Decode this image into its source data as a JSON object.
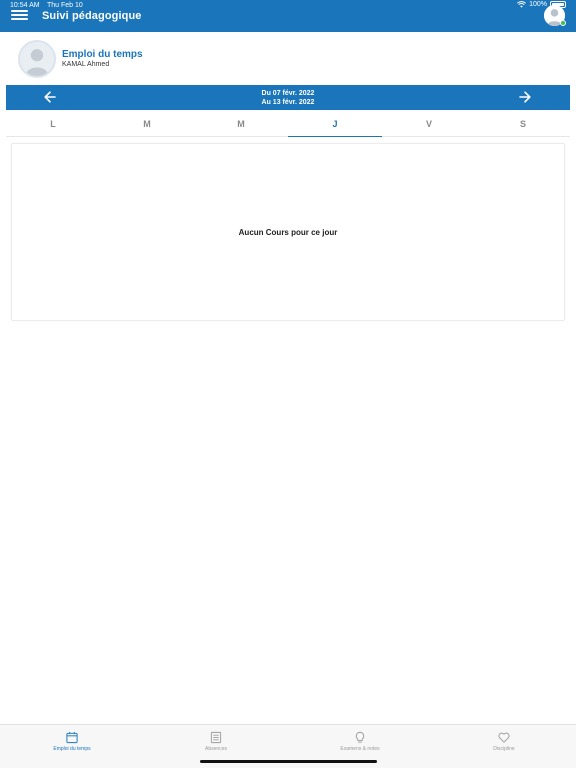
{
  "status_bar": {
    "time": "10:54 AM",
    "date": "Thu Feb 10",
    "battery": "100%"
  },
  "header": {
    "title": "Suivi pédagogique"
  },
  "profile": {
    "title": "Emploi du temps",
    "name": "KAMAL Ahmed"
  },
  "week": {
    "from": "Du 07 févr. 2022",
    "to": "Au 13 févr. 2022"
  },
  "days": [
    {
      "label": "L"
    },
    {
      "label": "M"
    },
    {
      "label": "M"
    },
    {
      "label": "J",
      "active": true
    },
    {
      "label": "V"
    },
    {
      "label": "S"
    }
  ],
  "content": {
    "empty_message": "Aucun Cours pour ce jour"
  },
  "bottom_tabs": [
    {
      "label": "Emploi du temps",
      "icon": "calendar-icon",
      "active": true
    },
    {
      "label": "Absences",
      "icon": "list-icon"
    },
    {
      "label": "Examens & notes",
      "icon": "lightbulb-icon"
    },
    {
      "label": "Discipline",
      "icon": "heart-icon"
    }
  ],
  "colors": {
    "primary": "#1a75bb",
    "online": "#39c14f",
    "inactive": "#9a9a9a"
  }
}
